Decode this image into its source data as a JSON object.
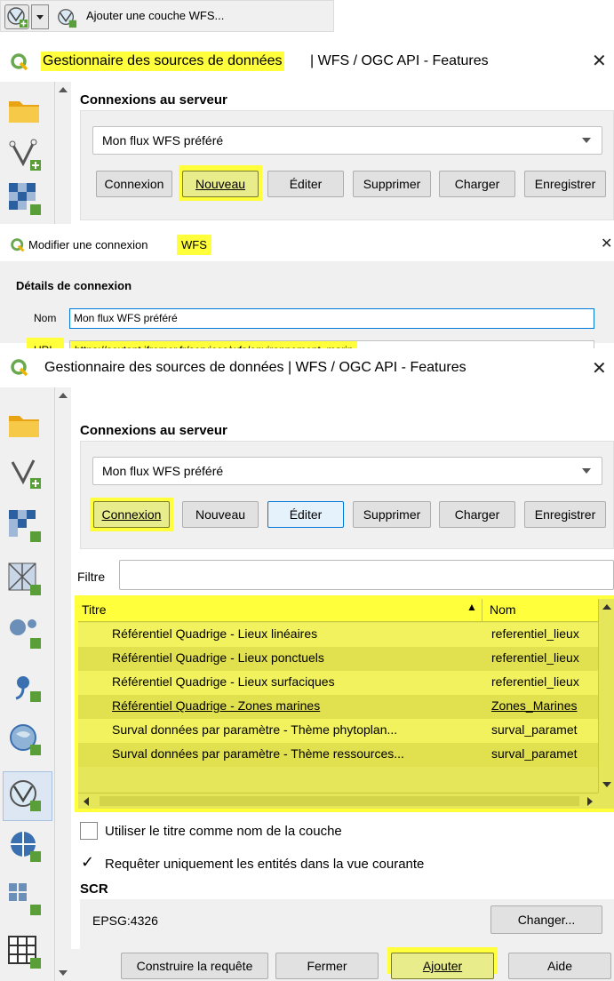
{
  "toolbar": {
    "wfs_action_label": "Ajouter une couche WFS..."
  },
  "dialog1": {
    "title_part1": "Gestionnaire des sources de données",
    "title_part2": " | WFS / OGC API - Features",
    "section": "Connexions au serveur",
    "combo_value": "Mon flux WFS préféré",
    "buttons": {
      "connect": "Connexion",
      "new": "Nouveau",
      "edit": "Éditer",
      "delete": "Supprimer",
      "load": "Charger",
      "save": "Enregistrer"
    }
  },
  "dialog2": {
    "title_part1": "Modifier une connexion ",
    "title_part2": "WFS",
    "section": "Détails de connexion",
    "name_label": "Nom",
    "name_value": "Mon flux WFS préféré",
    "url_label": "URL",
    "url_value": "https://sextant.ifremer.fr/services/wfs/environnement_marin"
  },
  "dialog3": {
    "title": "Gestionnaire des sources de données | WFS / OGC API - Features",
    "section": "Connexions au serveur",
    "combo_value": "Mon flux WFS préféré",
    "buttons": {
      "connect": "Connexion",
      "new": "Nouveau",
      "edit": "Éditer",
      "delete": "Supprimer",
      "load": "Charger",
      "save": "Enregistrer"
    },
    "filter_label": "Filtre",
    "filter_value": "",
    "table": {
      "col_title": "Titre",
      "col_name": "Nom",
      "rows": [
        {
          "title": "Référentiel Quadrige - Lieux linéaires",
          "name": "referentiel_lieux"
        },
        {
          "title": "Référentiel Quadrige - Lieux ponctuels",
          "name": "referentiel_lieux"
        },
        {
          "title": "Référentiel Quadrige - Lieux surfaciques",
          "name": "referentiel_lieux"
        },
        {
          "title": "Référentiel Quadrige - Zones marines",
          "name": "Zones_Marines"
        },
        {
          "title": "Surval données par paramètre - Thème phytoplan...",
          "name": "surval_paramet"
        },
        {
          "title": "Surval données par paramètre - Thème ressources...",
          "name": "surval_paramet"
        }
      ]
    },
    "check_title_label": "Utiliser le titre comme nom de la couche",
    "check_title_checked": false,
    "check_extent_label": "Requêter uniquement les entités dans la vue courante",
    "check_extent_checked": true,
    "crs_section": "SCR",
    "crs_value": "EPSG:4326",
    "change_label": "Changer...",
    "footer": {
      "build_query": "Construire la requête",
      "close": "Fermer",
      "add": "Ajouter",
      "help": "Aide"
    }
  }
}
